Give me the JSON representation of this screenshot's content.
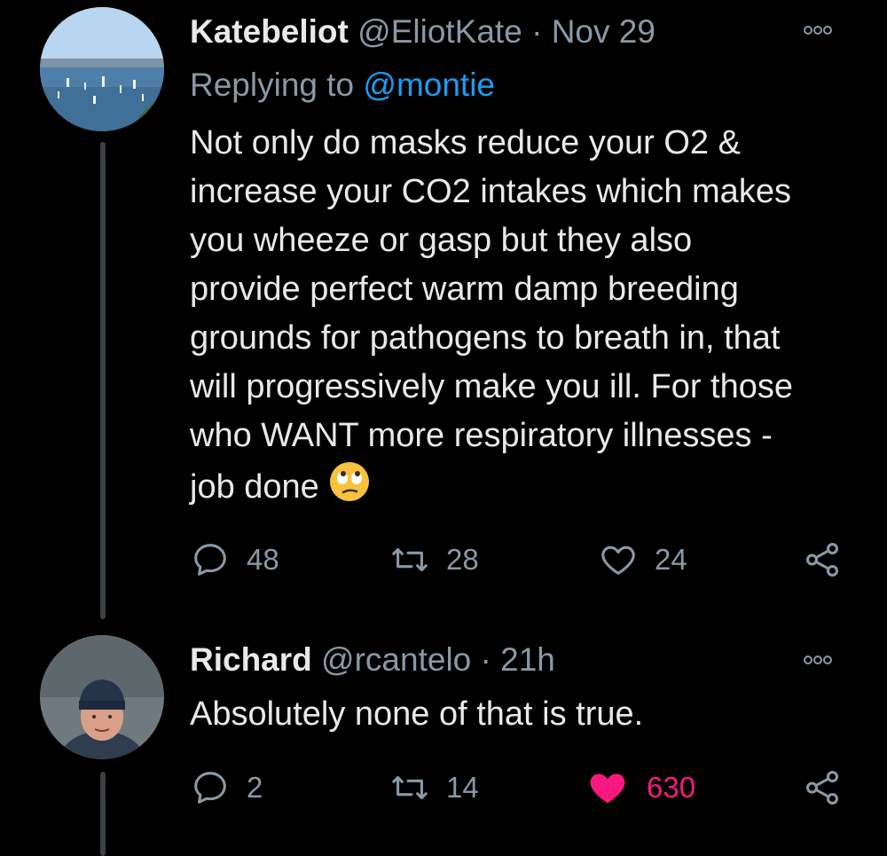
{
  "tweets": [
    {
      "name": "Katebeliot",
      "handle": "@EliotKate",
      "separator": "·",
      "time": "Nov 29",
      "replying_prefix": "Replying to",
      "replying_to": "@montie",
      "text": "Not only do masks reduce your O2 & increase your CO2 intakes which makes you wheeze or gasp but they also provide perfect warm damp breeding grounds for pathogens to breath in, that will progressively make you ill. For those who WANT more respiratory illnesses - job done",
      "emoji": "face-with-rolling-eyes",
      "replies": "48",
      "retweets": "28",
      "likes": "24",
      "liked": false
    },
    {
      "name": "Richard",
      "handle": "@rcantelo",
      "separator": "·",
      "time": "21h",
      "text": "Absolutely none of that is true.",
      "replies": "2",
      "retweets": "14",
      "likes": "630",
      "liked": true
    }
  ],
  "colors": {
    "background": "#000000",
    "text": "#e7e9ea",
    "secondary": "#8b98a5",
    "link": "#1d9bf0",
    "like": "#f91880",
    "thread_line": "#3d4146"
  }
}
